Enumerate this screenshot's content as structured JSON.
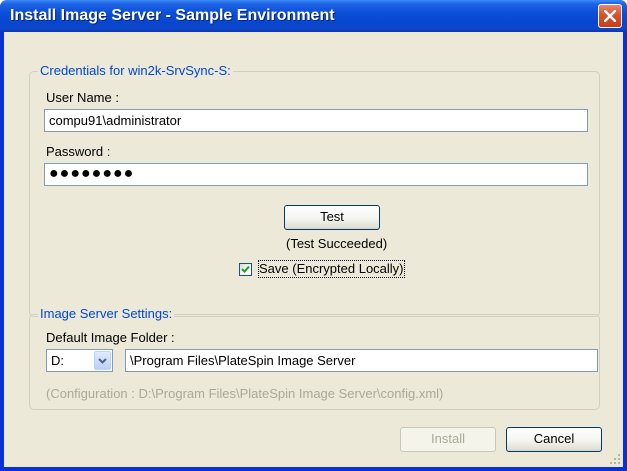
{
  "window": {
    "title": "Install Image Server - Sample Environment"
  },
  "credentials": {
    "group_label": "Credentials for win2k-SrvSync-S:",
    "user_name_label": "User Name :",
    "user_name_value": "compu91\\administrator",
    "password_label": "Password :",
    "password_value": "●●●●●●●●",
    "test_button": "Test",
    "test_status": "(Test Succeeded)",
    "save_label": "Save (Encrypted Locally)",
    "save_checked": true
  },
  "image_server": {
    "group_label": "Image Server Settings:",
    "folder_label": "Default Image Folder :",
    "drive_value": "D:",
    "folder_path": "\\Program Files\\PlateSpin Image Server",
    "config_hint": "(Configuration : D:\\Program Files\\PlateSpin Image Server\\config.xml)"
  },
  "footer": {
    "install_button": "Install",
    "cancel_button": "Cancel"
  },
  "icons": {
    "close": "close-icon",
    "check": "checkmark-icon",
    "dropdown": "chevron-down-icon",
    "grip": "resize-grip-icon"
  },
  "colors": {
    "title_bar": "#0a4fd8",
    "group_label": "#0046d5",
    "close_button": "#d8512e",
    "dialog_bg": "#ece9d8"
  }
}
